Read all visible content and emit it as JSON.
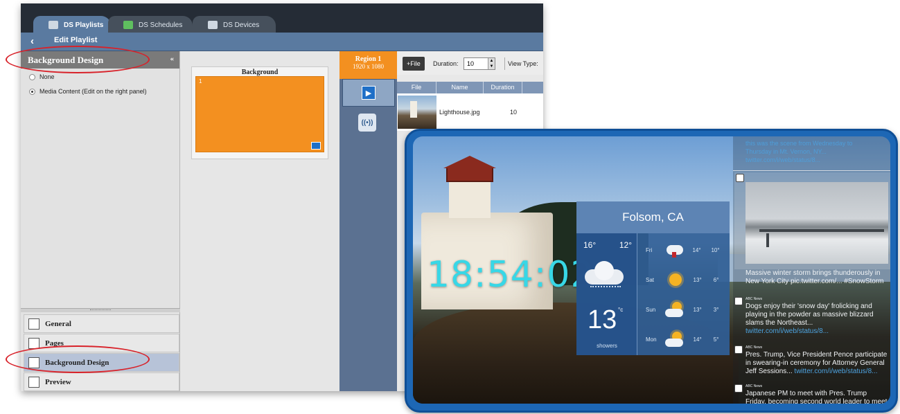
{
  "app": {
    "tabs": [
      {
        "label": "DS Playlists",
        "active": true,
        "icon": "playlist-icon"
      },
      {
        "label": "DS Schedules",
        "active": false,
        "icon": "schedule-icon"
      },
      {
        "label": "DS Devices",
        "active": false,
        "icon": "devices-icon"
      }
    ],
    "back_glyph": "‹",
    "subtitle": "Edit Playlist",
    "left_panel": {
      "title": "Background Design",
      "collapse_glyph": "«",
      "options": [
        {
          "label": "None",
          "selected": false
        },
        {
          "label": "Media Content (Edit on the right panel)",
          "selected": true
        }
      ],
      "nav": [
        {
          "label": "General",
          "icon": "general-icon",
          "selected": false
        },
        {
          "label": "Pages",
          "icon": "pages-icon",
          "selected": false
        },
        {
          "label": "Background Design",
          "icon": "background-design-icon",
          "selected": true
        },
        {
          "label": "Preview",
          "icon": "preview-icon",
          "selected": false
        }
      ]
    },
    "canvas": {
      "label": "Background",
      "region_number": "1",
      "color": "#f39020"
    },
    "region": {
      "title": "Region 1",
      "size": "1920 x 1080"
    },
    "files": {
      "add_label": "+File",
      "duration_label": "Duration:",
      "duration_value": "10",
      "view_type_label": "View Type:",
      "columns": [
        "File",
        "Name",
        "Duration"
      ],
      "rows": [
        {
          "name": "Lighthouse.jpg",
          "duration": "10"
        }
      ]
    }
  },
  "display": {
    "clock": "18:54:02",
    "weather": {
      "city": "Folsom, CA",
      "high": "16°",
      "low": "12°",
      "current_temp": "13",
      "current_unit": "°c",
      "condition": "showers",
      "forecast": [
        {
          "day": "Fri",
          "high": "14°",
          "low": "10°",
          "icon": "thunderstorm-icon"
        },
        {
          "day": "Sat",
          "high": "13°",
          "low": "6°",
          "icon": "sunny-icon"
        },
        {
          "day": "Sun",
          "high": "13°",
          "low": "3°",
          "icon": "partly-cloudy-icon"
        },
        {
          "day": "Mon",
          "high": "14°",
          "low": "5°",
          "icon": "partly-cloudy-icon"
        }
      ]
    },
    "feed": {
      "top_text": "this was the scene from Wednesday to Thursday in Mt. Vernon, NY... twitter.com/i/web/status/8...",
      "image_caption": "Massive winter storm brings thunderously in New York City pic.twitter.com/... #SnowStorm",
      "tweets": [
        {
          "handle": "ABC News",
          "text": "Dogs enjoy their 'snow day' frolicking and playing in the powder as massive blizzard slams the Northeast...",
          "link": "twitter.com/i/web/status/8..."
        },
        {
          "handle": "ABC News",
          "text": "Pres. Trump, Vice President Pence participate in swearing-in ceremony for Attorney General Jeff Sessions...",
          "link": "twitter.com/i/web/status/8..."
        },
        {
          "handle": "ABC News",
          "text": "Japanese PM to meet with Pres. Trump Friday, becoming second world leader to meet",
          "link": ""
        }
      ]
    }
  },
  "colors": {
    "accent_orange": "#f39020",
    "annotation_red": "#d8222a",
    "frame_blue": "#1d67b5",
    "clock_cyan": "#38d7e6"
  }
}
